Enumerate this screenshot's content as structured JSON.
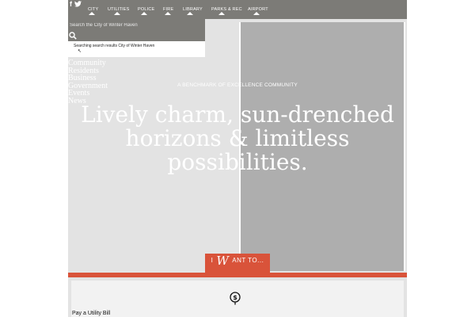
{
  "header": {
    "social": [
      {
        "icon": "facebook-icon",
        "glyph": "f"
      },
      {
        "icon": "twitter-icon",
        "glyph": "t"
      }
    ],
    "nav": [
      "CITY",
      "UTILITIES",
      "POLICE",
      "FIRE",
      "LIBRARY",
      "PARKS & REC",
      "AIRPORT"
    ]
  },
  "search": {
    "placeholder": "Search the City of Winter Haven",
    "suggestion": "Searching search results City of Winter Haven"
  },
  "side_links": [
    "Community",
    "Residents",
    "Business",
    "Government",
    "Events",
    "News"
  ],
  "hero": {
    "tagline": "A BENCHMARK OF EXCELLENCE COMMUNITY",
    "headline": "Lively charm, sun-drenched horizons & limitless possibilities."
  },
  "i_want": {
    "prefix": "I",
    "initial": "W",
    "rest": "ANT TO..."
  },
  "tiles": [
    {
      "label": "Pay a Utility Bill",
      "icon": "dollar-icon"
    }
  ],
  "colors": {
    "accent": "#d9533a",
    "bar": "#7c7b77",
    "panel": "#aeaeae",
    "background": "#e3e3e3"
  }
}
